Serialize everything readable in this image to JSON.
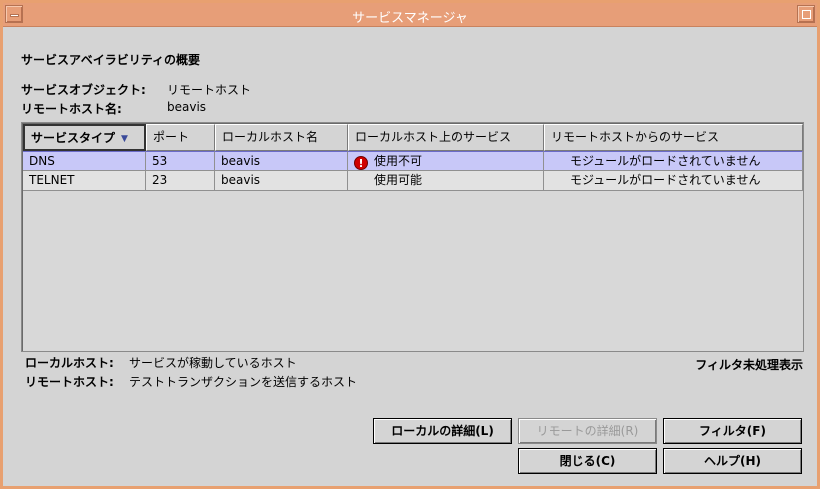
{
  "window": {
    "title": "サービスマネージャ"
  },
  "heading": "サービスアベイラビリティの概要",
  "service_object": {
    "label": "サービスオブジェクト:",
    "value": "リモートホスト"
  },
  "remote_host_name": {
    "label": "リモートホスト名:",
    "value": "beavis"
  },
  "table": {
    "columns": [
      "サービスタイプ",
      "ポート",
      "ローカルホスト名",
      "ローカルホスト上のサービス",
      "リモートホストからのサービス"
    ],
    "rows": [
      {
        "service_type": "DNS",
        "port": "53",
        "local_host": "beavis",
        "local_service": "使用不可",
        "local_error": true,
        "remote_service": "モジュールがロードされていません"
      },
      {
        "service_type": "TELNET",
        "port": "23",
        "local_host": "beavis",
        "local_service": "使用可能",
        "local_error": false,
        "remote_service": "モジュールがロードされていません"
      }
    ]
  },
  "legend": {
    "local": {
      "label": "ローカルホスト:",
      "text": "サービスが稼動しているホスト"
    },
    "remote": {
      "label": "リモートホスト:",
      "text": "テストトランザクションを送信するホスト"
    }
  },
  "filter_status": "フィルタ未処理表示",
  "buttons": {
    "local_details": "ローカルの詳細(L)",
    "remote_details": "リモートの詳細(R)",
    "filter": "フィルタ(F)",
    "close": "閉じる(C)",
    "help": "ヘルプ(H)"
  }
}
